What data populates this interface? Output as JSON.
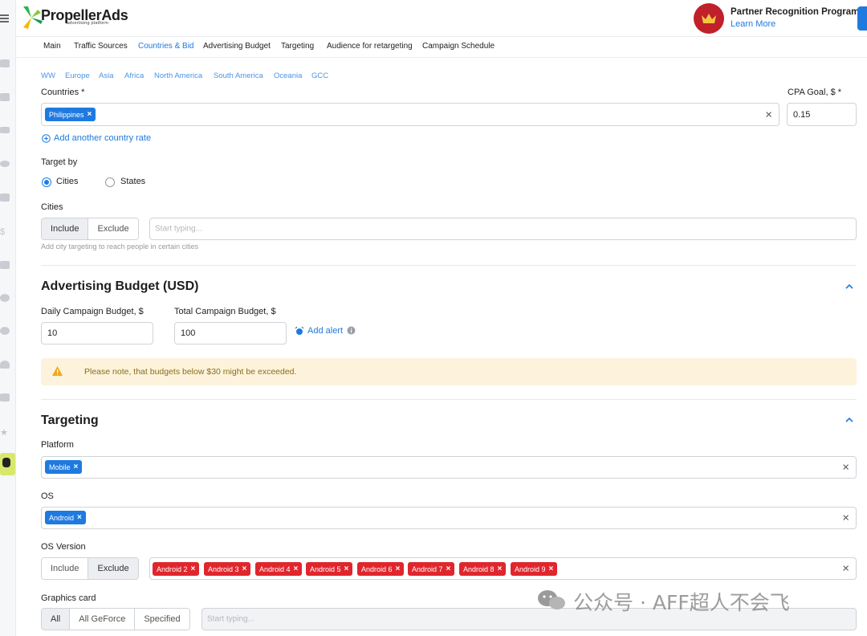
{
  "brand": {
    "name": "PropellerAds",
    "tagline": "advertising platform"
  },
  "partner": {
    "title": "Partner Recognition Program",
    "link": "Learn More"
  },
  "tabs": [
    "Main",
    "Traffic Sources",
    "Countries & Bid",
    "Advertising Budget",
    "Targeting",
    "Audience for retargeting",
    "Campaign Schedule"
  ],
  "active_tab": "Countries & Bid",
  "regions": [
    "WW",
    "Europe",
    "Asia",
    "Africa",
    "North America",
    "South America",
    "Oceania",
    "GCC"
  ],
  "countries": {
    "label": "Countries *",
    "selected": [
      "Philippines"
    ],
    "add_link": "Add another country rate",
    "cpa_label": "CPA Goal, $ *",
    "cpa_value": "0.15"
  },
  "target_by": {
    "label": "Target by",
    "options": [
      "Cities",
      "States"
    ],
    "selected": "Cities"
  },
  "cities": {
    "label": "Cities",
    "modes": [
      "Include",
      "Exclude"
    ],
    "mode_selected": "Include",
    "placeholder": "Start typing...",
    "hint": "Add city targeting to reach people in certain cities"
  },
  "budget": {
    "title": "Advertising Budget (USD)",
    "daily_label": "Daily Campaign Budget, $",
    "daily_value": "10",
    "total_label": "Total Campaign Budget, $",
    "total_value": "100",
    "alert_link": "Add alert",
    "warning": "Please note, that budgets below $30 might be exceeded."
  },
  "targeting": {
    "title": "Targeting",
    "platform_label": "Platform",
    "platform_selected": [
      "Mobile"
    ],
    "os_label": "OS",
    "os_selected": [
      "Android"
    ],
    "os_version_label": "OS Version",
    "os_version_modes": [
      "Include",
      "Exclude"
    ],
    "os_version_mode_selected": "Exclude",
    "os_versions": [
      "Android 2",
      "Android 3",
      "Android 4",
      "Android 5",
      "Android 6",
      "Android 7",
      "Android 8",
      "Android 9"
    ],
    "graphics_label": "Graphics card",
    "graphics_modes": [
      "All",
      "All GeForce",
      "Specified"
    ],
    "graphics_mode_selected": "All",
    "graphics_placeholder": "Start typing..."
  },
  "watermark": "公众号 · AFF超人不会飞",
  "colors": {
    "accent": "#1f7ae0",
    "chip_red": "#e0262d",
    "warning_bg": "#fdf3dc",
    "crown_bg": "#c0202a"
  }
}
